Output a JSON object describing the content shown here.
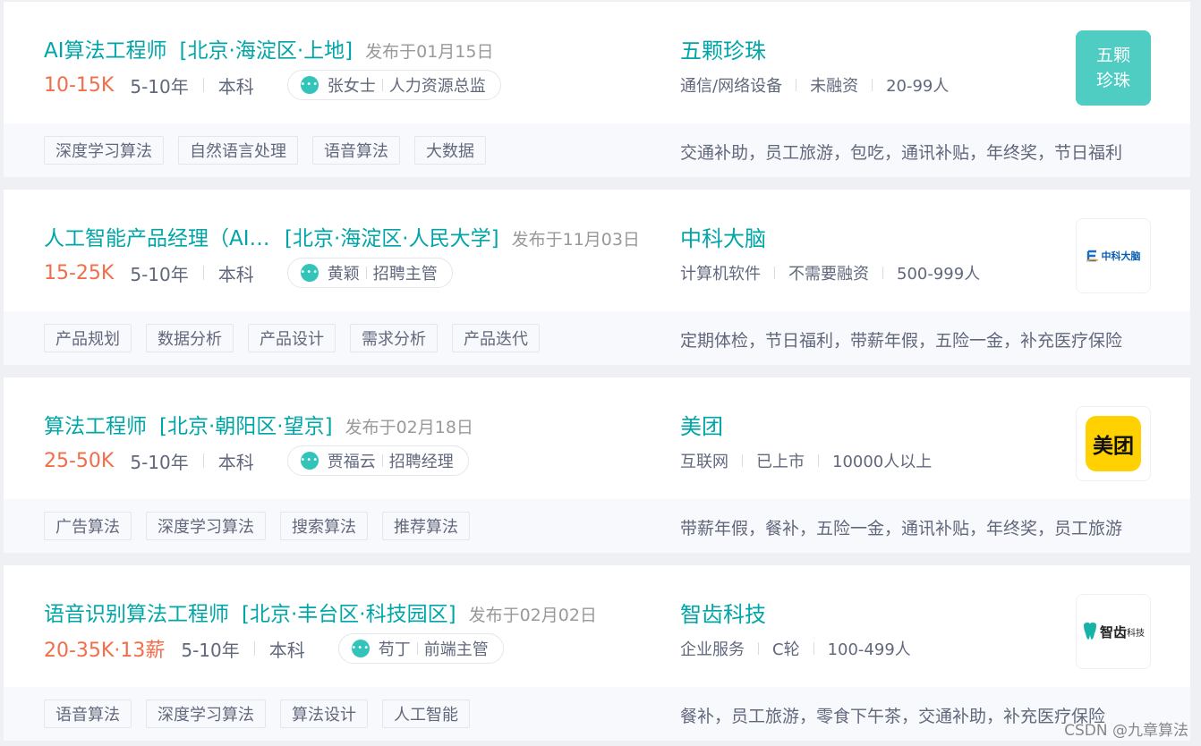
{
  "jobs": [
    {
      "name": "AI算法工程师",
      "area": "[北京·海淀区·上地]",
      "published": "发布于01月15日",
      "salary": "10-15K",
      "experience": "5-10年",
      "education": "本科",
      "recruiter_name": "张女士",
      "recruiter_title": "人力资源总监",
      "company": "五颗珍珠",
      "company_info": [
        "通信/网络设备",
        "未融资",
        "20-99人"
      ],
      "logo_text": "五颗珍珠",
      "tags": [
        "深度学习算法",
        "自然语言处理",
        "语音算法",
        "大数据"
      ],
      "welfare": "交通补助，员工旅游，包吃，通讯补贴，年终奖，节日福利"
    },
    {
      "name": "人工智能产品经理（AI方向）",
      "area": "[北京·海淀区·人民大学]",
      "published": "发布于11月03日",
      "salary": "15-25K",
      "experience": "5-10年",
      "education": "本科",
      "recruiter_name": "黄颖",
      "recruiter_title": "招聘主管",
      "company": "中科大脑",
      "company_info": [
        "计算机软件",
        "不需要融资",
        "500-999人"
      ],
      "logo_text": "中科大脑",
      "tags": [
        "产品规划",
        "数据分析",
        "产品设计",
        "需求分析",
        "产品迭代"
      ],
      "welfare": "定期体检，节日福利，带薪年假，五险一金，补充医疗保险"
    },
    {
      "name": "算法工程师",
      "area": "[北京·朝阳区·望京]",
      "published": "发布于02月18日",
      "salary": "25-50K",
      "experience": "5-10年",
      "education": "本科",
      "recruiter_name": "贾福云",
      "recruiter_title": "招聘经理",
      "company": "美团",
      "company_info": [
        "互联网",
        "已上市",
        "10000人以上"
      ],
      "logo_text": "美团",
      "tags": [
        "广告算法",
        "深度学习算法",
        "搜索算法",
        "推荐算法"
      ],
      "welfare": "带薪年假，餐补，五险一金，通讯补贴，年终奖，员工旅游"
    },
    {
      "name": "语音识别算法工程师",
      "area": "[北京·丰台区·科技园区]",
      "published": "发布于02月02日",
      "salary": "20-35K·13薪",
      "experience": "5-10年",
      "education": "本科",
      "recruiter_name": "苟丁",
      "recruiter_title": "前端主管",
      "company": "智齿科技",
      "company_info": [
        "企业服务",
        "C轮",
        "100-499人"
      ],
      "logo_text": "智齿",
      "logo_subtext": "科技",
      "tags": [
        "语音算法",
        "深度学习算法",
        "算法设计",
        "人工智能"
      ],
      "welfare": "餐补，员工旅游，零食下午茶，交通补助，补充医疗保险"
    }
  ],
  "watermark": "CSDN @九章算法",
  "colors": {
    "accent": "#00a6a7",
    "salary": "#f26d49",
    "logo_teal": "#4fcdc3",
    "meituan_yellow": "#ffd100"
  }
}
